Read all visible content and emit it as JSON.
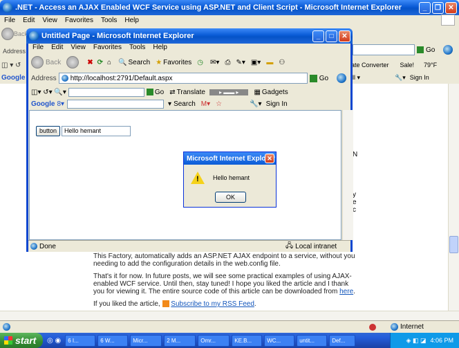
{
  "outer": {
    "title": ".NET - Access an AJAX Enabled WCF Service using ASP.NET and Client Script - Microsoft Internet Explorer",
    "menu": [
      "File",
      "Edit",
      "View",
      "Favorites",
      "Tools",
      "Help"
    ],
    "address_label": "Address",
    "back_label": "Back",
    "go_label": "Go",
    "google_label": "Google",
    "toolbar_right": {
      "rate_converter": "ate Converter",
      "sale": "Sale!",
      "temp": "79°F",
      "sign_in": "Sign In"
    },
    "side_letters": [
      "N",
      "y",
      "e",
      "c"
    ],
    "status": {
      "done": "",
      "zone": "Internet"
    },
    "blog": {
      "p1": "This Factory, automatically adds an ASP.NET AJAX endpoint to a service, without you needing to add the configuration details in the web.config file.",
      "p2_pre": "That's it for now. In future posts, we will see some practical examples of using AJAX-enabled WCF service. Until then, stay tuned! I hope you liked the article and I thank you for viewing it. The entire source code of this article can be downloaded from ",
      "p2_link": "here",
      "p2_post": ".",
      "p3_pre": "If you liked the article, ",
      "p3_link": "Subscribe to my RSS Feed",
      "p3_post": "."
    }
  },
  "inner": {
    "title": "Untitled Page - Microsoft Internet Explorer",
    "menu": [
      "File",
      "Edit",
      "View",
      "Favorites",
      "Tools",
      "Help"
    ],
    "back_label": "Back",
    "search_label": "Search",
    "favorites_label": "Favorites",
    "address_label": "Address",
    "url": "http://localhost:2791/Default.aspx",
    "go_label": "Go",
    "translate_label": "Translate",
    "gadgets_label": "Gadgets",
    "google_label": "Google",
    "search2_label": "Search",
    "sign_in": "Sign In",
    "page": {
      "button_label": "button",
      "input_value": "Hello hemant"
    },
    "status": {
      "done": "Done",
      "zone": "Local intranet"
    }
  },
  "dialog": {
    "title": "Microsoft Internet Explorer",
    "message": "Hello hemant",
    "ok": "OK"
  },
  "taskbar": {
    "start": "start",
    "tasks": [
      "6 I...",
      "6 W...",
      "Micr...",
      "2 M...",
      "Omr...",
      "KE.B...",
      "WC...",
      "untit...",
      "Def..."
    ],
    "time": "4:06 PM"
  }
}
